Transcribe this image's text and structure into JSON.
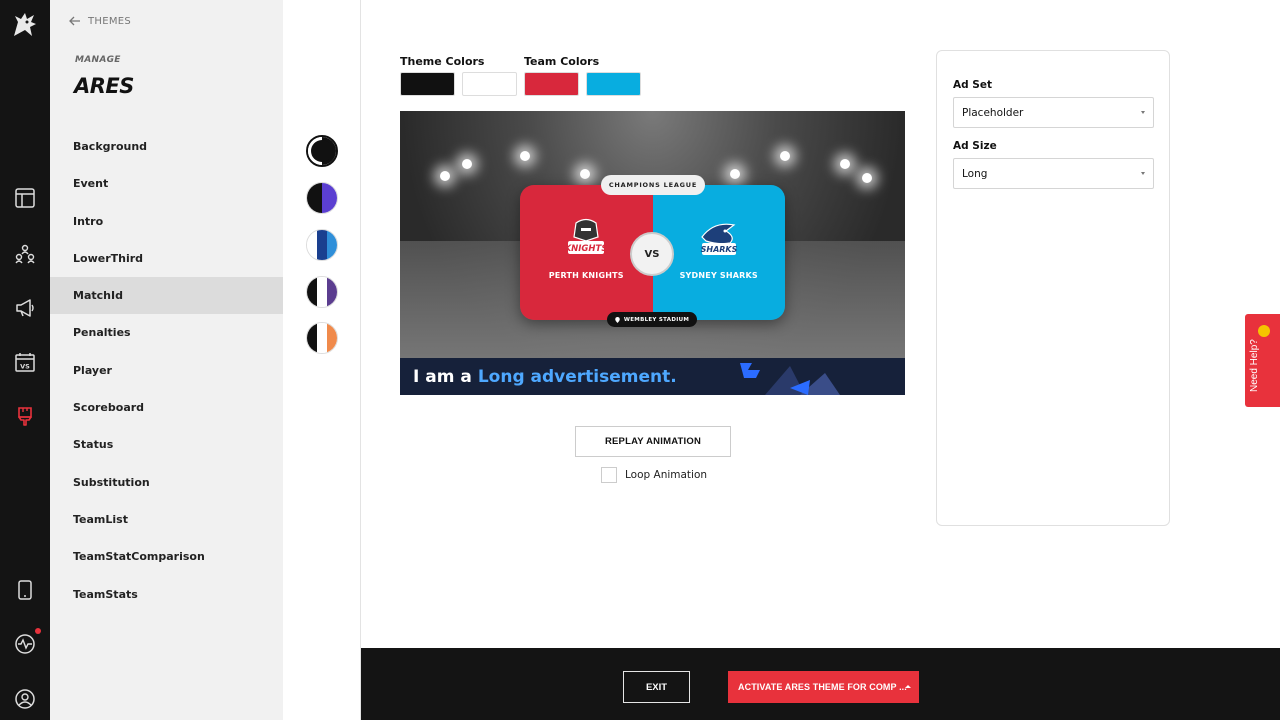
{
  "nav": {
    "back_label": "THEMES",
    "manage_label": "MANAGE",
    "theme_name": "ARES",
    "items": [
      {
        "label": "Background"
      },
      {
        "label": "Event"
      },
      {
        "label": "Intro"
      },
      {
        "label": "LowerThird"
      },
      {
        "label": "MatchId",
        "active": true
      },
      {
        "label": "Penalties"
      },
      {
        "label": "Player"
      },
      {
        "label": "Scoreboard"
      },
      {
        "label": "Status"
      },
      {
        "label": "Substitution"
      },
      {
        "label": "TeamList"
      },
      {
        "label": "TeamStatComparison"
      },
      {
        "label": "TeamStats"
      }
    ]
  },
  "rail": {
    "icons": [
      "logo-icon",
      "layout-icon",
      "users-icon",
      "megaphone-icon",
      "versus-calendar-icon",
      "paintbrush-icon",
      "tablet-icon",
      "activity-icon",
      "profile-icon"
    ]
  },
  "swatches": [
    {
      "colors": [
        "#111111",
        "#ffffff"
      ],
      "selected": true
    },
    {
      "colors": [
        "#111111",
        "#5b3fd1"
      ]
    },
    {
      "colors": [
        "#ffffff",
        "#1a3f8f",
        "#2f8fd9"
      ]
    },
    {
      "colors": [
        "#111111",
        "#ffffff",
        "#5b3d8f"
      ]
    },
    {
      "colors": [
        "#111111",
        "#ffffff",
        "#f08a4b"
      ]
    }
  ],
  "colors": {
    "theme_label": "Theme Colors",
    "team_label": "Team Colors",
    "theme": [
      "#111111",
      "#ffffff"
    ],
    "team": [
      "#d8283c",
      "#08ade0"
    ]
  },
  "preview": {
    "league": "CHAMPIONS LEAGUE",
    "home_team": "PERTH KNIGHTS",
    "away_team": "SYDNEY SHARKS",
    "home_logo_text": "KNIGHTS",
    "away_logo_text": "SHARKS",
    "vs": "VS",
    "venue": "WEMBLEY STADIUM",
    "ad_text_prefix": "I am a",
    "ad_text_highlight": "Long advertisement."
  },
  "controls": {
    "replay_label": "REPLAY ANIMATION",
    "loop_label": "Loop Animation",
    "loop_checked": false
  },
  "ad_panel": {
    "ad_set_label": "Ad Set",
    "ad_set_value": "Placeholder",
    "ad_size_label": "Ad Size",
    "ad_size_value": "Long"
  },
  "footer": {
    "exit_label": "EXIT",
    "activate_label": "ACTIVATE ARES THEME FOR COMP ..."
  },
  "help": {
    "label": "Need Help?"
  },
  "accent": "#e8323c"
}
